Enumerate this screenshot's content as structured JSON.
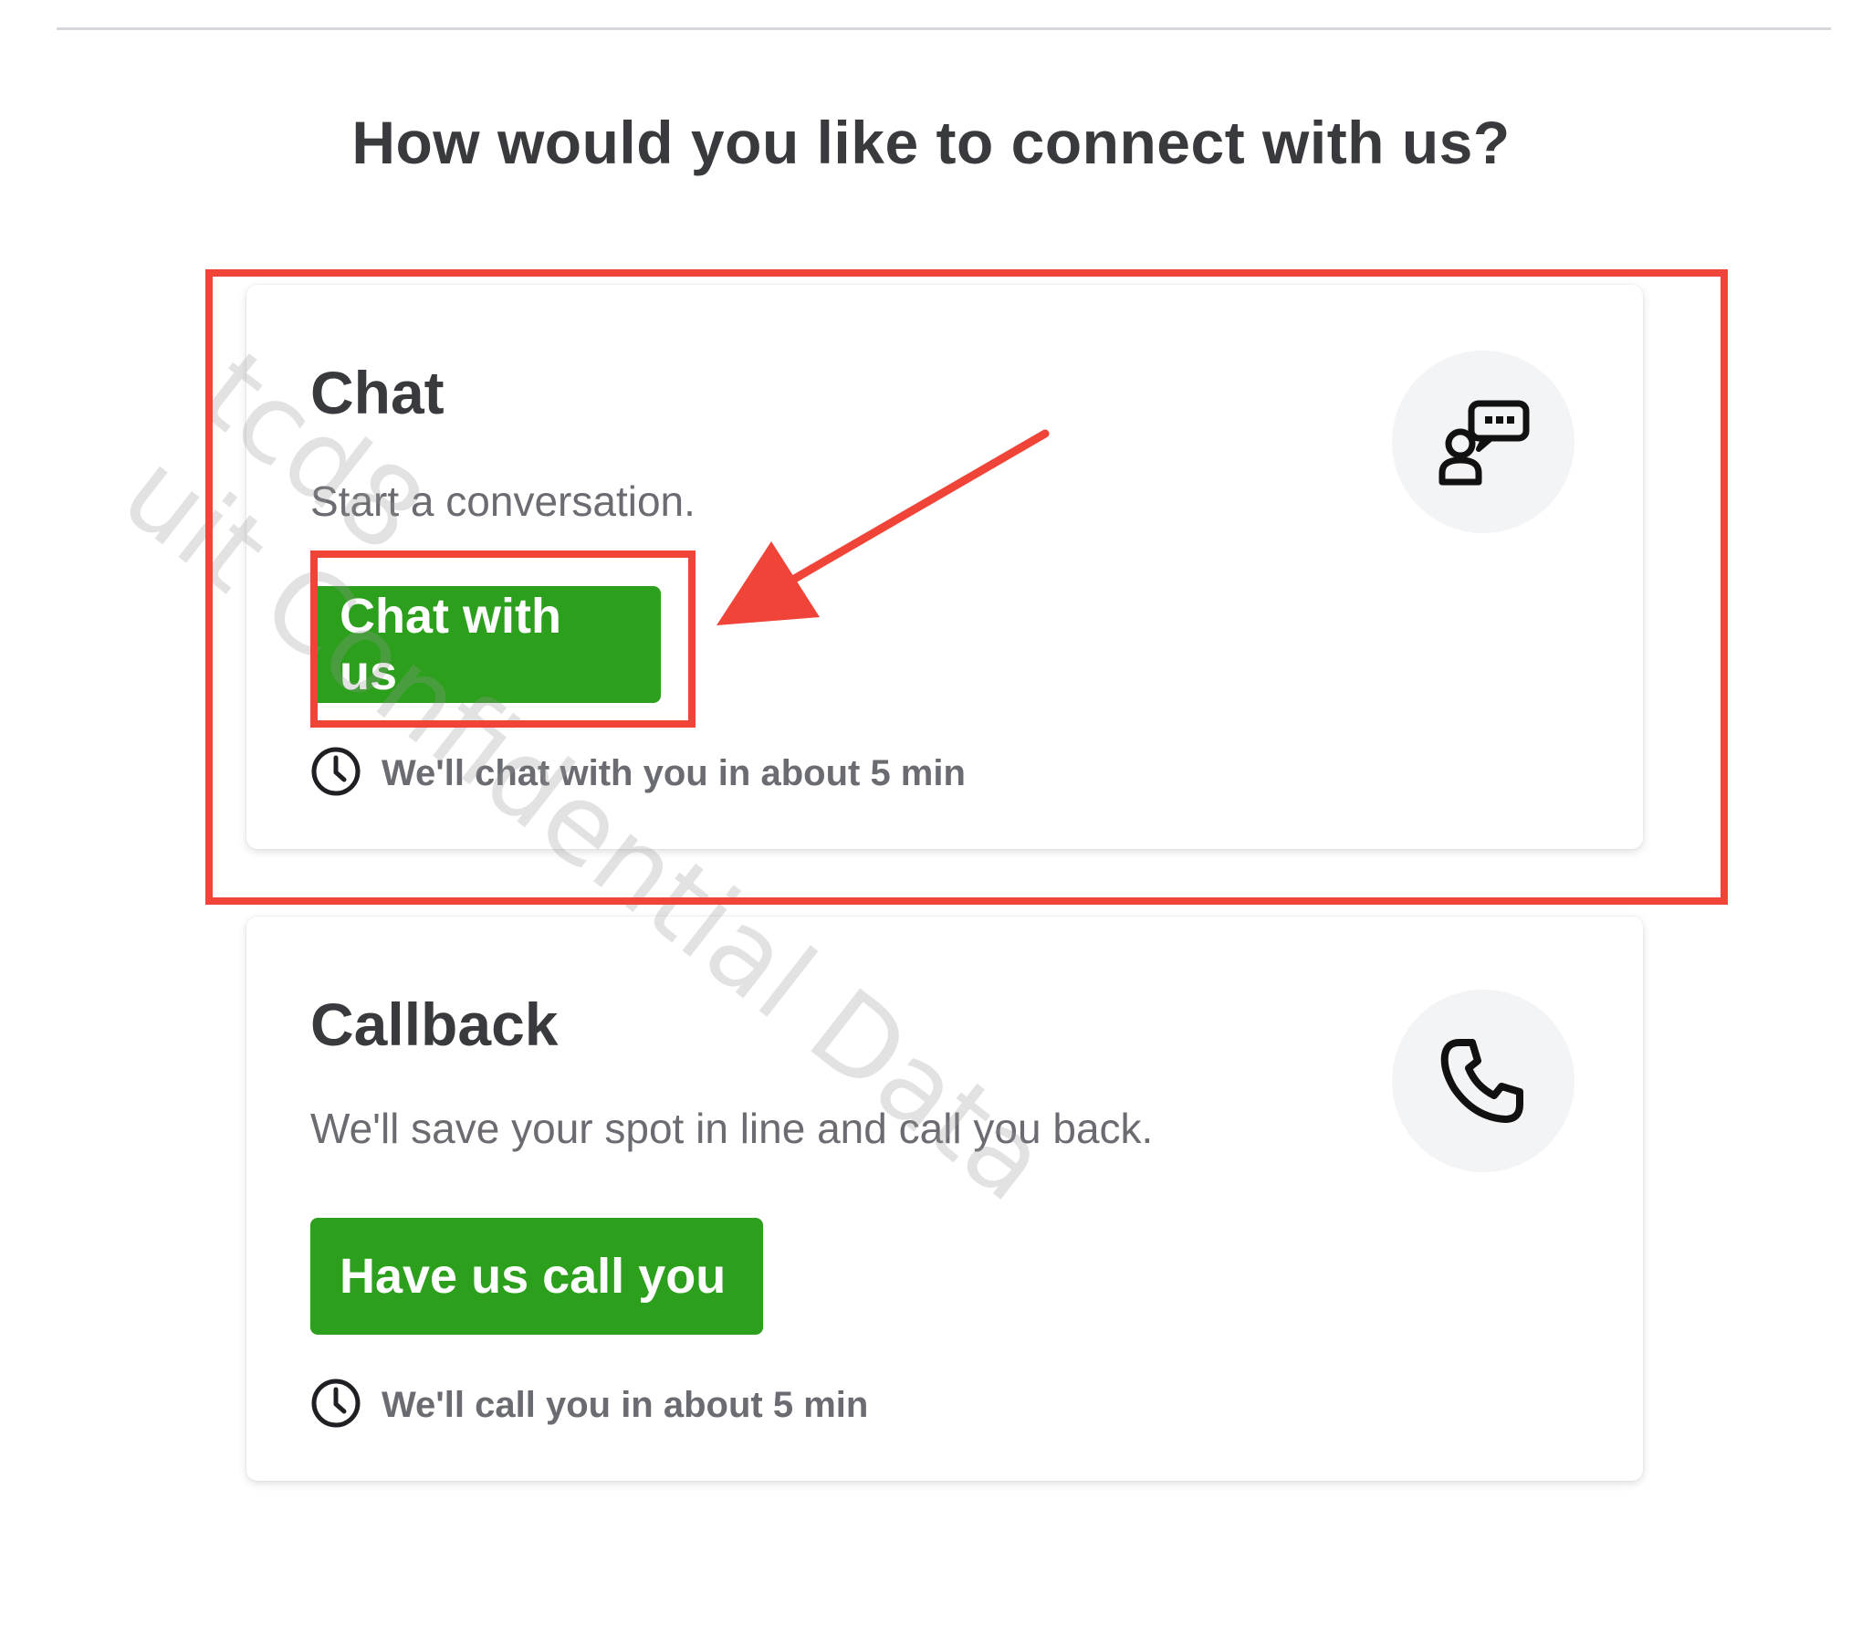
{
  "page": {
    "title": "How would you like to connect with us?"
  },
  "chat_card": {
    "title": "Chat",
    "description": "Start a conversation.",
    "button_label": "Chat with us",
    "eta": "We'll chat with you in about 5 min",
    "icon": "chat-agent-icon"
  },
  "callback_card": {
    "title": "Callback",
    "description": "We'll save your spot in line and call you back.",
    "button_label": "Have us call you",
    "eta": "We'll call you in about 5 min",
    "icon": "phone-icon"
  },
  "watermark": {
    "line1": "tcd8",
    "line2": "uit Confidential Data"
  },
  "colors": {
    "button_green": "#2ca01c",
    "annotation_red": "#f04438",
    "text_dark": "#393a3d",
    "text_muted": "#6b6c72"
  }
}
